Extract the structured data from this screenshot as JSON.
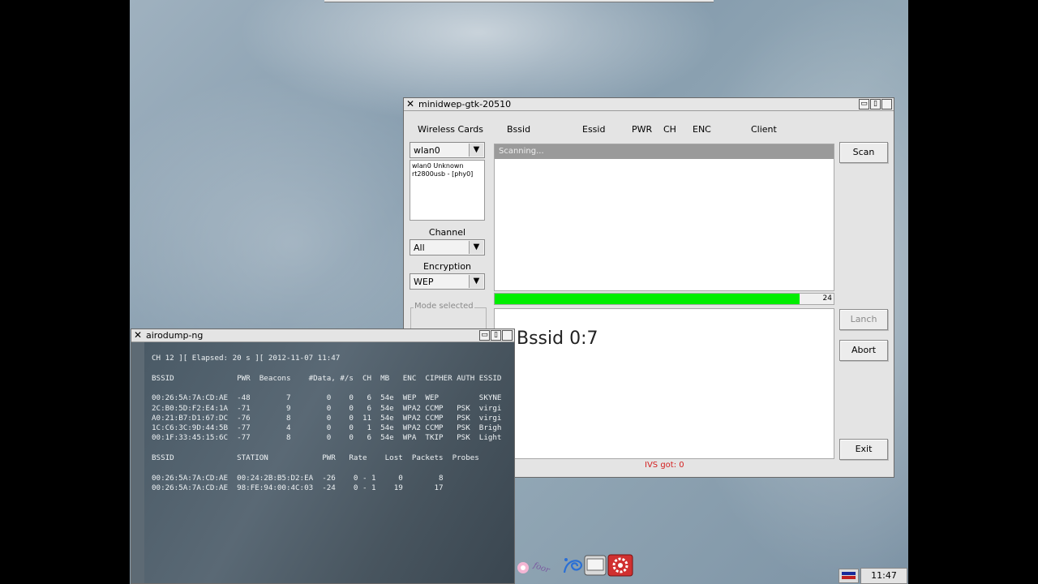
{
  "minidwep": {
    "title": "minidwep-gtk-20510",
    "col_wireless_cards": "Wireless Cards",
    "col_bssid": "Bssid",
    "col_essid": "Essid",
    "col_pwr": "PWR",
    "col_ch": "CH",
    "col_enc": "ENC",
    "col_client": "Client",
    "card_select": "wlan0",
    "card_info_line1": "wlan0 Unknown",
    "card_info_line2": "rt2800usb - [phy0]",
    "channel_label": "Channel",
    "channel_select": "All",
    "encryption_label": "Encryption",
    "encryption_select": "WEP",
    "mode_label": "Mode selected",
    "scanning_text": "Scanning...",
    "progress_value": 24,
    "progress_fraction": 0.9,
    "ivs_text": "IVS got: 0",
    "bg_text": "Bssid 0:7",
    "buttons": {
      "scan": "Scan",
      "lanch": "Lanch",
      "abort": "Abort",
      "exit": "Exit"
    }
  },
  "airodump": {
    "title": "airodump-ng",
    "lines": [
      "CH 12 ][ Elapsed: 20 s ][ 2012-11-07 11:47",
      "",
      "BSSID              PWR  Beacons    #Data, #/s  CH  MB   ENC  CIPHER AUTH ESSID",
      "",
      "00:26:5A:7A:CD:AE  -48        7        0    0   6  54e  WEP  WEP         SKYNE",
      "2C:B0:5D:F2:E4:1A  -71        9        0    0   6  54e  WPA2 CCMP   PSK  virgi",
      "A0:21:B7:D1:67:DC  -76        8        0    0  11  54e  WPA2 CCMP   PSK  virgi",
      "1C:C6:3C:9D:44:5B  -77        4        0    0   1  54e  WPA2 CCMP   PSK  Brigh",
      "00:1F:33:45:15:6C  -77        8        0    0   6  54e  WPA  TKIP   PSK  Light",
      "",
      "BSSID              STATION            PWR   Rate    Lost  Packets  Probes",
      "",
      "00:26:5A:7A:CD:AE  00:24:2B:B5:D2:EA  -26    0 - 1     0        8",
      "00:26:5A:7A:CD:AE  98:FE:94:00:4C:03  -24    0 - 1    19       17"
    ]
  },
  "taskbar": {
    "clock": "11:47"
  }
}
